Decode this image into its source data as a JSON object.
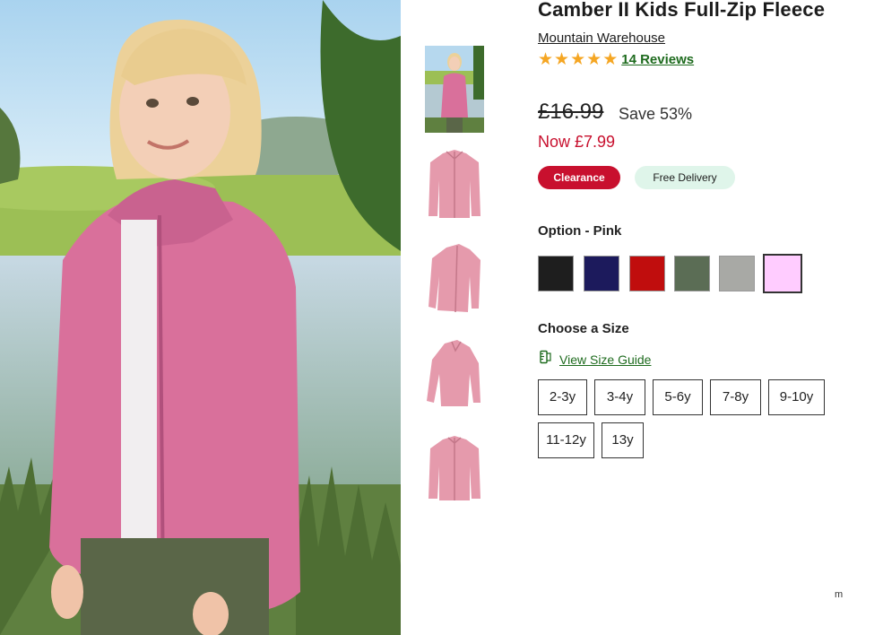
{
  "product": {
    "title": "Camber II Kids Full-Zip Fleece",
    "brand": "Mountain Warehouse",
    "rating_stars": 5,
    "reviews_label": "14 Reviews",
    "old_price": "£16.99",
    "save_text": "Save 53%",
    "now_price": "Now £7.99"
  },
  "badges": {
    "clearance": "Clearance",
    "delivery": "Free Delivery"
  },
  "option": {
    "label": "Option - Pink",
    "swatches": [
      {
        "name": "black",
        "color": "#1e1e1e"
      },
      {
        "name": "navy",
        "color": "#1c1a5c"
      },
      {
        "name": "red",
        "color": "#c00d0d"
      },
      {
        "name": "green",
        "color": "#5b6d55"
      },
      {
        "name": "grey",
        "color": "#a8a9a5"
      },
      {
        "name": "pink",
        "color": "#ffccff",
        "selected": true
      }
    ]
  },
  "size": {
    "heading": "Choose a Size",
    "guide_label": "View Size Guide",
    "options": [
      "2-3y",
      "3-4y",
      "5-6y",
      "7-8y",
      "9-10y",
      "11-12y",
      "13y"
    ]
  },
  "icons": {
    "star": "star-icon",
    "size_guide": "ruler-icon"
  },
  "colors": {
    "accent_green": "#1e6b1e",
    "sale_red": "#c8102e",
    "star_gold": "#f5a623",
    "delivery_bg": "#dff5ea",
    "fleece_pink": "#d9709b"
  },
  "footer_mark": "m"
}
